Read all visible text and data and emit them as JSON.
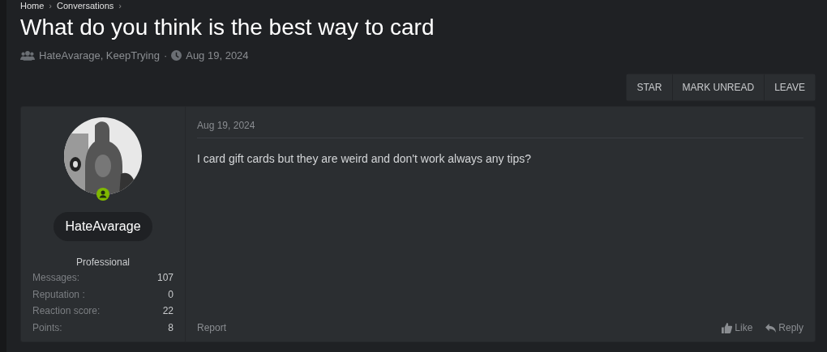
{
  "breadcrumb": {
    "items": [
      "Home",
      "Conversations"
    ],
    "separator": "›"
  },
  "title": "What do you think is the best way to card",
  "meta": {
    "participants": "HateAvarage, KeepTrying",
    "separator": "·",
    "date": "Aug 19, 2024"
  },
  "actions": [
    "STAR",
    "MARK UNREAD",
    "LEAVE"
  ],
  "message": {
    "user": {
      "online": true,
      "name": "HateAvarage",
      "title": "Professional",
      "stats": [
        {
          "label": "Messages:",
          "value": "107"
        },
        {
          "label": "Reputation :",
          "value": "0"
        },
        {
          "label": "Reaction score:",
          "value": "22"
        },
        {
          "label": "Points:",
          "value": "8"
        }
      ]
    },
    "date": "Aug 19, 2024",
    "body": "I card gift cards but they are weird and don't work always any tips?",
    "report": "Report",
    "like": "Like",
    "reply": "Reply"
  }
}
